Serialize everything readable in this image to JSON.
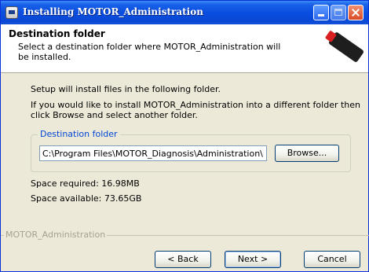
{
  "window": {
    "title": "Installing MOTOR_Administration"
  },
  "header": {
    "title": "Destination folder",
    "description": "Select a destination folder where MOTOR_Administration will be installed."
  },
  "body": {
    "intro": "Setup will install files in the following folder.",
    "instructions_line1": "If you would like to install MOTOR_Administration into a different folder then",
    "instructions_line2": "click Browse and select another folder.",
    "group_label": "Destination folder",
    "path_value": "C:\\Program Files\\MOTOR_Diagnosis\\Administration\\MOTOR_Administration",
    "browse_label": "Browse...",
    "space_required": "Space required: 16.98MB",
    "space_available": "Space available: 73.65GB"
  },
  "footer": {
    "brand": "MOTOR_Administration",
    "back_label": "< Back",
    "next_label": "Next >",
    "cancel_label": "Cancel"
  }
}
